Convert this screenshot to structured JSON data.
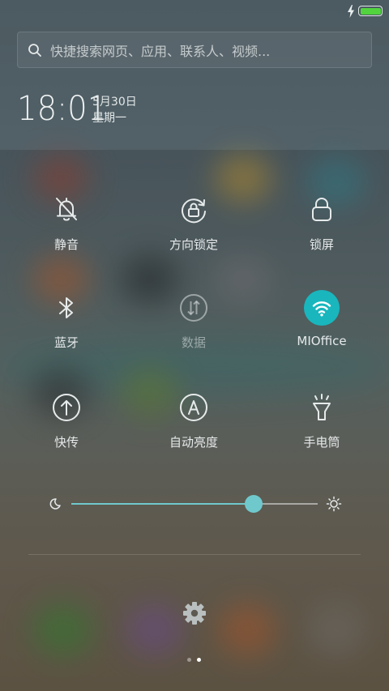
{
  "status_bar": {
    "charging": true,
    "battery_level": 1.0,
    "battery_color": "#52d43e"
  },
  "search": {
    "placeholder": "快捷搜索网页、应用、联系人、视频..."
  },
  "clock": {
    "time": "18:01",
    "date": "5月30日",
    "weekday": "星期一"
  },
  "toggles": [
    {
      "id": "mute",
      "label": "静音",
      "icon": "bell-off-icon",
      "active": false,
      "enabled": true
    },
    {
      "id": "rotation-lock",
      "label": "方向锁定",
      "icon": "rotation-lock-icon",
      "active": false,
      "enabled": true
    },
    {
      "id": "lock-screen",
      "label": "锁屏",
      "icon": "lock-icon",
      "active": false,
      "enabled": true
    },
    {
      "id": "bluetooth",
      "label": "蓝牙",
      "icon": "bluetooth-icon",
      "active": false,
      "enabled": true
    },
    {
      "id": "mobile-data",
      "label": "数据",
      "icon": "data-transfer-icon",
      "active": false,
      "enabled": false
    },
    {
      "id": "wifi",
      "label": "MIOffice",
      "icon": "wifi-icon",
      "active": true,
      "enabled": true
    },
    {
      "id": "quick-share",
      "label": "快传",
      "icon": "upload-icon",
      "active": false,
      "enabled": true
    },
    {
      "id": "auto-brightness",
      "label": "自动亮度",
      "icon": "auto-brightness-icon",
      "active": false,
      "enabled": true
    },
    {
      "id": "flashlight",
      "label": "手电筒",
      "icon": "flashlight-icon",
      "active": false,
      "enabled": true
    }
  ],
  "brightness": {
    "level": 0.74,
    "accent": "#6fc8cc"
  },
  "accent_color": "#19b6bd",
  "pager": {
    "pages": 2,
    "current": 2
  }
}
